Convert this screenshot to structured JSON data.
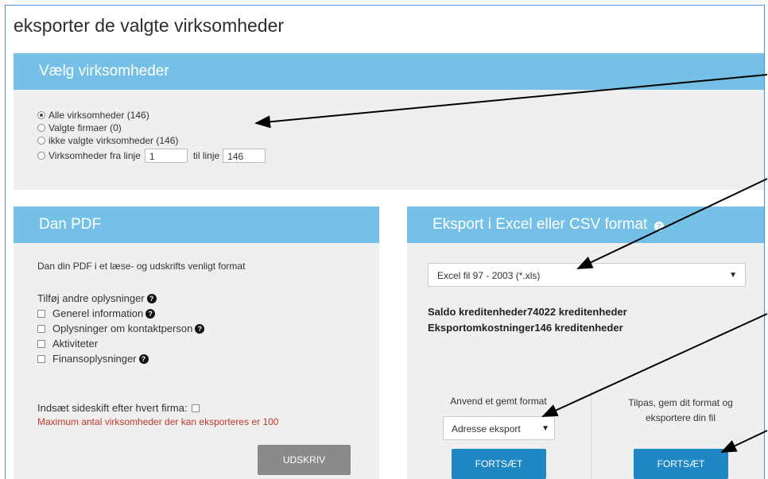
{
  "page_title": "eksporter de valgte virksomheder",
  "vaelg": {
    "header": "Vælg virksomheder",
    "options": [
      {
        "label": "Alle virksomheder (146)",
        "checked": true
      },
      {
        "label": "Valgte firmaer (0)",
        "checked": false
      },
      {
        "label": "ikke valgte virksomheder (146)",
        "checked": false
      }
    ],
    "range_label": "Virksomheder fra linje",
    "range_from": "1",
    "range_to_label": "til linje",
    "range_to": "146"
  },
  "pdf": {
    "header": "Dan PDF",
    "description": "Dan din PDF i et læse- og udskrifts venligt format",
    "extra_title": "Tilføj andre oplysninger",
    "checkboxes": [
      {
        "label": "Generel information",
        "help": true
      },
      {
        "label": "Oplysninger om kontaktperson",
        "help": true
      },
      {
        "label": "Aktiviteter",
        "help": false
      },
      {
        "label": "Finansoplysninger",
        "help": true
      }
    ],
    "pagebreak_label": "Indsæt sideskift efter hvert firma:",
    "warning": "Maximum antal virksomheder der kan eksporteres er 100",
    "print_button": "UDSKRIV"
  },
  "excel": {
    "header": "Eksport i Excel eller CSV format",
    "format_selected": "Excel fil 97 - 2003 (*.xls)",
    "saldo": "Saldo kreditenheder",
    "saldo_value": "74022 kreditenheder",
    "cost": "Eksportomkostninger",
    "cost_value": "146 kreditenheder",
    "saved_title": "Anvend et gemt format",
    "saved_selected": "Adresse eksport",
    "custom_title": "Tilpas, gem dit format og eksportere din fil",
    "continue_left": "FORTSÆT",
    "continue_right": "FORTSÆT"
  },
  "colors": {
    "header": "#74c0e7",
    "panel_bg": "#efefef",
    "button_blue": "#1f87c4",
    "button_gray": "#8a8a8a",
    "warning": "#c0392b"
  }
}
